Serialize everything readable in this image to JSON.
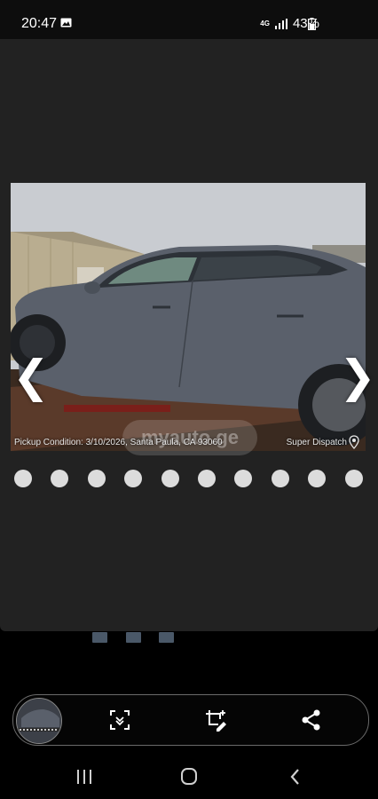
{
  "status_bar": {
    "time": "20:47",
    "network": "4G",
    "battery": "43%",
    "icons": [
      "gallery-icon",
      "signal-icon",
      "battery-icon"
    ]
  },
  "viewer": {
    "caption": "Pickup Condition: 3/10/2026, Santa Paula, CA 93060",
    "source": "Super Dispatch",
    "watermark": "myauto.ge",
    "prev_arrow": "❮",
    "next_arrow": "❯",
    "dot_count": 10,
    "icons": [
      "location-pin-icon"
    ]
  },
  "thumbnails": {
    "count": 3
  },
  "toolbar": {
    "icons": [
      "scan-icon",
      "edit-crop-icon",
      "share-icon"
    ]
  },
  "navigation": {
    "icons": [
      "recents-icon",
      "home-icon",
      "back-icon"
    ]
  },
  "colors": {
    "panel": "#222222",
    "background": "#000000",
    "dot": "#dcdcdc"
  }
}
